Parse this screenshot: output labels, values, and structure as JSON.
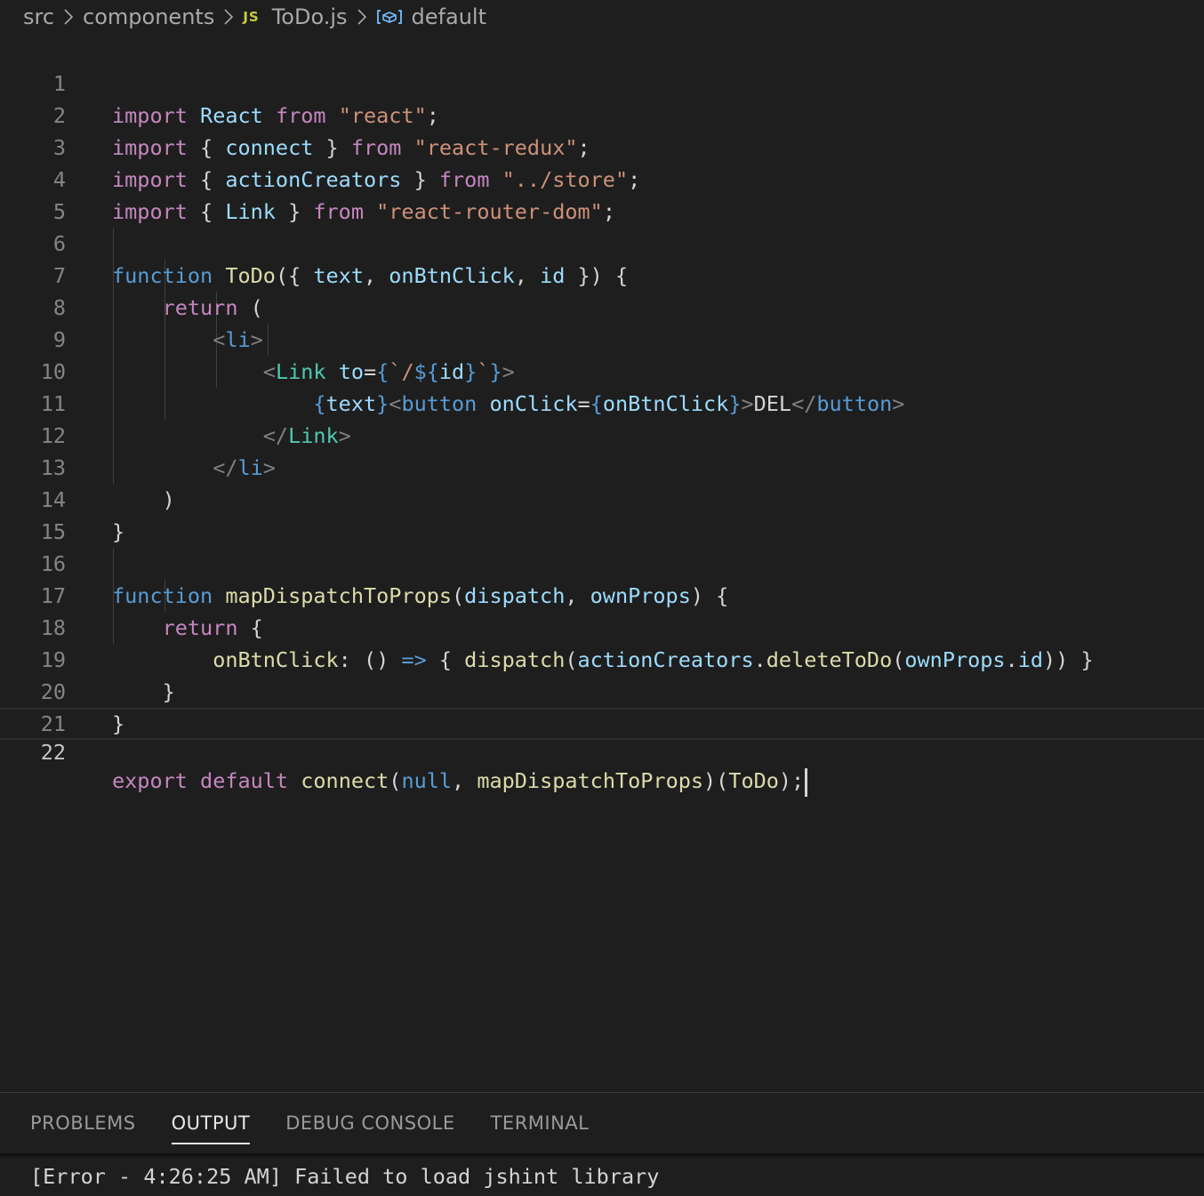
{
  "breadcrumb": {
    "folder1": "src",
    "folder2": "components",
    "file_icon": "JS",
    "file": "ToDo.js",
    "symbol_icon": "symbol-variable-icon",
    "symbol": "default"
  },
  "editor": {
    "line_numbers": [
      "1",
      "2",
      "3",
      "4",
      "5",
      "6",
      "7",
      "8",
      "9",
      "10",
      "11",
      "12",
      "13",
      "14",
      "15",
      "16",
      "17",
      "18",
      "19",
      "20",
      "21",
      "22"
    ],
    "active_line": 22
  },
  "panel": {
    "tabs": [
      "PROBLEMS",
      "OUTPUT",
      "DEBUG CONSOLE",
      "TERMINAL"
    ],
    "active_tab": "OUTPUT",
    "output_text": "[Error - 4:26:25 AM] Failed to load jshint library"
  }
}
